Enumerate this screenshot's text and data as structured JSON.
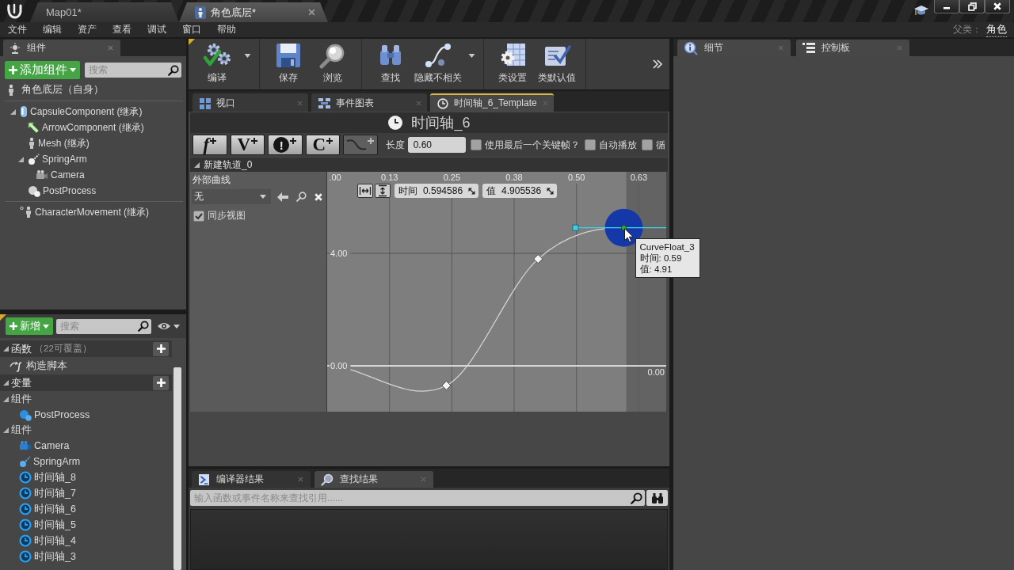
{
  "title_bar": {
    "tabs": [
      {
        "label": "Map01*",
        "kind": "level",
        "selected": false
      },
      {
        "label": "角色底层*",
        "kind": "blueprint",
        "selected": true
      }
    ]
  },
  "menu_bar": {
    "items": [
      "文件",
      "编辑",
      "资产",
      "查看",
      "调试",
      "窗口",
      "帮助"
    ],
    "parent_class_label": "父类：",
    "parent_class": "角色"
  },
  "components_panel": {
    "tab": "组件",
    "add_button": "添加组件",
    "search": {
      "placeholder": "搜索"
    },
    "root": {
      "label": "角色底层（自身）"
    },
    "tree": [
      {
        "label": "CapsuleComponent (继承)",
        "kind": "capsule",
        "expanded": true,
        "children": [
          {
            "label": "ArrowComponent (继承)",
            "kind": "arrow"
          },
          {
            "label": "Mesh (继承)",
            "kind": "mesh"
          },
          {
            "label": "SpringArm",
            "kind": "spring_arm",
            "expanded": true,
            "children": [
              {
                "label": "Camera",
                "kind": "camera"
              }
            ]
          },
          {
            "label": "PostProcess",
            "kind": "post_process"
          }
        ]
      }
    ],
    "other": [
      {
        "label": "CharacterMovement (继承)",
        "kind": "movement"
      }
    ]
  },
  "my_blueprint_panel": {
    "add_button": "新增",
    "search": {
      "placeholder": "搜索"
    },
    "sections": [
      {
        "label": "函数",
        "note": "（22可覆盖）",
        "expanded": true,
        "items": [
          {
            "label": "构造脚本",
            "kind": "construction_script"
          }
        ]
      },
      {
        "label": "变量",
        "expanded": true,
        "categories": [
          {
            "label": "组件",
            "expanded": true,
            "items": [
              {
                "label": "PostProcess",
                "kind": "post_process"
              }
            ]
          },
          {
            "label": "组件",
            "expanded": true,
            "items": [
              {
                "label": "Camera",
                "kind": "camera"
              },
              {
                "label": "SpringArm",
                "kind": "spring_arm"
              },
              {
                "label": "时间轴_8",
                "kind": "timeline"
              },
              {
                "label": "时间轴_7",
                "kind": "timeline"
              },
              {
                "label": "时间轴_6",
                "kind": "timeline"
              },
              {
                "label": "时间轴_5",
                "kind": "timeline"
              },
              {
                "label": "时间轴_4",
                "kind": "timeline"
              },
              {
                "label": "时间轴_3",
                "kind": "timeline"
              }
            ]
          }
        ]
      }
    ]
  },
  "toolbar": {
    "groups": [
      {
        "buttons": [
          {
            "label": "编译",
            "kind": "compile",
            "has_menu": true
          }
        ]
      },
      {
        "buttons": [
          {
            "label": "保存",
            "kind": "save",
            "has_menu": false
          },
          {
            "label": "浏览",
            "kind": "browse",
            "has_menu": false
          }
        ]
      },
      {
        "buttons": [
          {
            "label": "查找",
            "kind": "find",
            "has_menu": false
          },
          {
            "label": "隐藏不相关",
            "kind": "hide_unrelated",
            "has_menu": true
          }
        ]
      },
      {
        "buttons": [
          {
            "label": "类设置",
            "kind": "class_settings",
            "has_menu": false
          },
          {
            "label": "类默认值",
            "kind": "class_defaults",
            "has_menu": false
          }
        ]
      }
    ]
  },
  "document_tabs": [
    {
      "label": "视口",
      "kind": "viewport",
      "selected": false
    },
    {
      "label": "事件图表",
      "kind": "event_graph",
      "selected": false
    },
    {
      "label": "时间轴_6_Template",
      "kind": "timeline",
      "selected": true
    }
  ],
  "timeline_editor": {
    "title": "时间轴_6",
    "add_track_buttons": [
      {
        "kind": "float",
        "glyph": "f",
        "disabled": false
      },
      {
        "kind": "vector",
        "glyph": "V",
        "disabled": false
      },
      {
        "kind": "event",
        "glyph": "!",
        "disabled": false
      },
      {
        "kind": "color",
        "glyph": "C",
        "disabled": false
      },
      {
        "kind": "external_curve",
        "disabled": true
      }
    ],
    "length_label": "长度",
    "length": "0.60",
    "options": [
      {
        "label": "使用最后一个关键帧？",
        "checked": false
      },
      {
        "label": "自动播放",
        "checked": false
      },
      {
        "label": "循",
        "checked": false
      }
    ],
    "track": {
      "label": "新建轨道_0",
      "expanded": true,
      "external_curve_label": "外部曲线",
      "external_curve": {
        "value": "无"
      },
      "sync_view": {
        "label": "同步视图",
        "checked": true
      },
      "time_field": {
        "label": "时间",
        "value": "0.594586"
      },
      "value_field": {
        "label": "值",
        "value": "4.905536"
      },
      "chart_data": {
        "type": "line",
        "x": [
          0,
          0.239,
          0.423,
          0.595
        ],
        "values": [
          0,
          -0.7,
          3.8,
          4.91
        ],
        "xlim": [
          0,
          0.68
        ],
        "ylim": [
          -1.63,
          6.9
        ],
        "xticks": [
          {
            "value": 0,
            "label": ".00"
          },
          {
            "value": 0.125,
            "label": "0.13"
          },
          {
            "value": 0.25,
            "label": "0.25"
          },
          {
            "value": 0.375,
            "label": "0.38"
          },
          {
            "value": 0.5,
            "label": "0.50"
          },
          {
            "value": 0.625,
            "label": "0.63"
          }
        ],
        "yticks": [
          {
            "value": 4,
            "label": "4.00"
          },
          {
            "value": 0,
            "label": "0.00"
          }
        ],
        "grid": true,
        "ref_lines": [
          {
            "axis": "y",
            "value": 4
          }
        ],
        "annotations": [
          "0.00"
        ]
      },
      "keys": [
        {
          "selected": false
        },
        {
          "selected": false
        },
        {
          "selected": true
        }
      ],
      "tooltip": {
        "title": "CurveFloat_3",
        "lines": [
          "时间: 0.59",
          "值: 4.91"
        ]
      }
    }
  },
  "bottom_panel": {
    "tabs": [
      {
        "label": "编译器结果",
        "kind": "compiler_results",
        "selected": false
      },
      {
        "label": "查找结果",
        "kind": "find_results",
        "selected": true
      }
    ],
    "search": {
      "placeholder": "输入函数或事件名称来查找引用......"
    }
  },
  "details_panel": {
    "tabs": [
      {
        "label": "细节",
        "kind": "details"
      },
      {
        "label": "控制板",
        "kind": "palette"
      }
    ]
  }
}
